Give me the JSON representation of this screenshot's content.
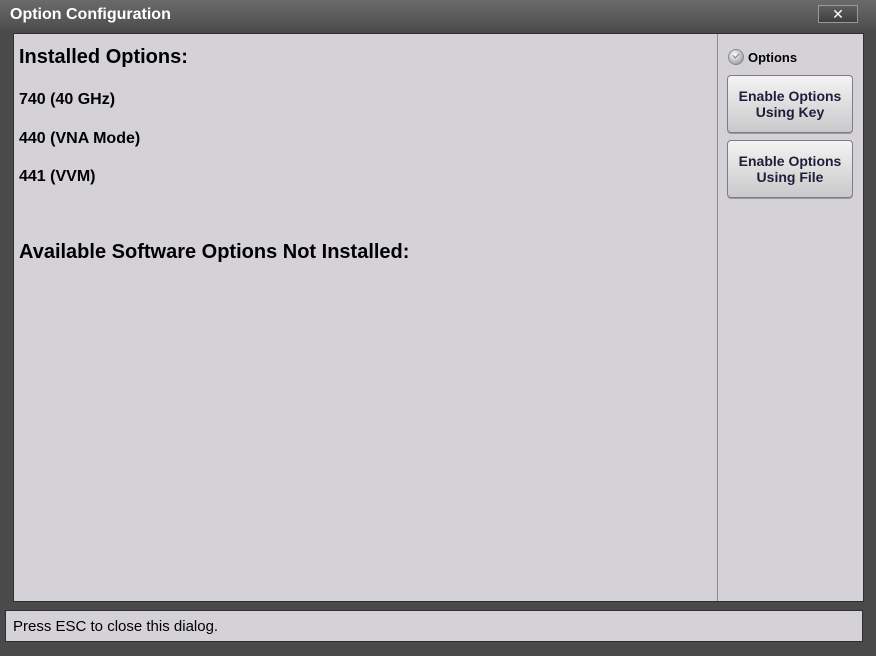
{
  "window": {
    "title": "Option Configuration",
    "close_glyph": "✕"
  },
  "main": {
    "installed_heading": "Installed Options:",
    "installed_options": [
      "740 (40 GHz)",
      "440 (VNA Mode)",
      "441 (VVM)"
    ],
    "not_installed_heading": "Available Software Options Not Installed:"
  },
  "side": {
    "options_radio_label": "Options",
    "options_radio_icon": "radio-check-icon",
    "enable_key_button": [
      "Enable Options",
      "Using Key"
    ],
    "enable_file_button": [
      "Enable Options",
      "Using File"
    ]
  },
  "status": {
    "text": "Press ESC to close this dialog."
  }
}
